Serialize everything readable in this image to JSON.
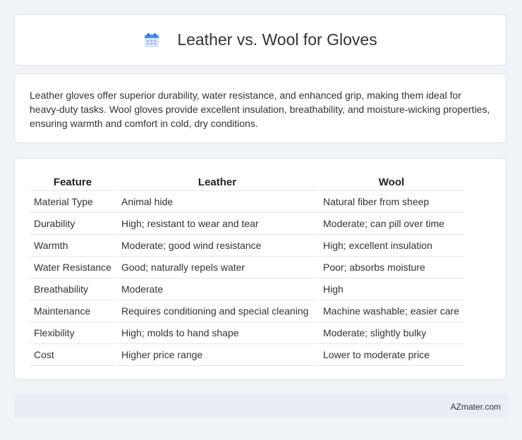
{
  "header": {
    "title": "Leather vs. Wool for Gloves",
    "icon": "calendar-icon"
  },
  "intro": {
    "text": "Leather gloves offer superior durability, water resistance, and enhanced grip, making them ideal for heavy-duty tasks. Wool gloves provide excellent insulation, breathability, and moisture-wicking properties, ensuring warmth and comfort in cold, dry conditions."
  },
  "table": {
    "headers": [
      "Feature",
      "Leather",
      "Wool"
    ],
    "rows": [
      [
        "Material Type",
        "Animal hide",
        "Natural fiber from sheep"
      ],
      [
        "Durability",
        "High; resistant to wear and tear",
        "Moderate; can pill over time"
      ],
      [
        "Warmth",
        "Moderate; good wind resistance",
        "High; excellent insulation"
      ],
      [
        "Water Resistance",
        "Good; naturally repels water",
        "Poor; absorbs moisture"
      ],
      [
        "Breathability",
        "Moderate",
        "High"
      ],
      [
        "Maintenance",
        "Requires conditioning and special cleaning",
        "Machine washable; easier care"
      ],
      [
        "Flexibility",
        "High; molds to hand shape",
        "Moderate; slightly bulky"
      ],
      [
        "Cost",
        "Higher price range",
        "Lower to moderate price"
      ]
    ]
  },
  "footer": {
    "brand": "AZmater.com"
  }
}
